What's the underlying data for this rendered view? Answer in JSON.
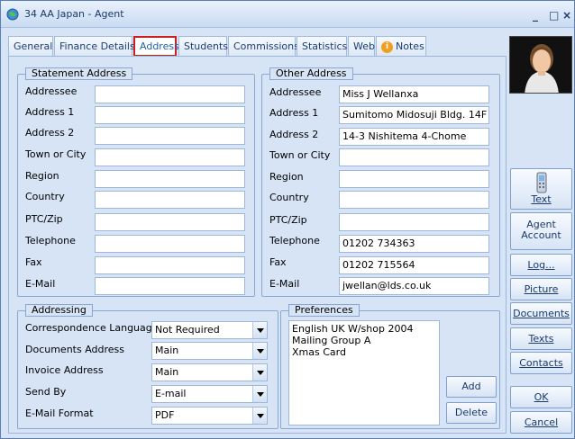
{
  "window": {
    "title": "34 AA Japan - Agent",
    "title_icon": "globe-icon"
  },
  "tabs": [
    {
      "label": "General",
      "active": false
    },
    {
      "label": "Finance Details",
      "active": false
    },
    {
      "label": "Address",
      "active": true
    },
    {
      "label": "Students",
      "active": false
    },
    {
      "label": "Commissions",
      "active": false
    },
    {
      "label": "Statistics",
      "active": false
    },
    {
      "label": "Web",
      "active": false
    },
    {
      "label": "Notes",
      "active": false,
      "icon": "info-icon"
    }
  ],
  "statement_address": {
    "title": "Statement Address",
    "fields": [
      {
        "label": "Addressee",
        "value": ""
      },
      {
        "label": "Address 1",
        "value": ""
      },
      {
        "label": "Address 2",
        "value": ""
      },
      {
        "label": "Town or City",
        "value": ""
      },
      {
        "label": "Region",
        "value": ""
      },
      {
        "label": "Country",
        "value": ""
      },
      {
        "label": "PTC/Zip",
        "value": ""
      },
      {
        "label": "Telephone",
        "value": ""
      },
      {
        "label": "Fax",
        "value": ""
      },
      {
        "label": "E-Mail",
        "value": ""
      }
    ]
  },
  "other_address": {
    "title": "Other Address",
    "fields": [
      {
        "label": "Addressee",
        "value": "Miss J Wellanxa"
      },
      {
        "label": "Address 1",
        "value": "Sumitomo Midosuji Bldg. 14F"
      },
      {
        "label": "Address 2",
        "value": "14-3 Nishitema 4-Chome"
      },
      {
        "label": "Town or City",
        "value": ""
      },
      {
        "label": "Region",
        "value": ""
      },
      {
        "label": "Country",
        "value": ""
      },
      {
        "label": "PTC/Zip",
        "value": ""
      },
      {
        "label": "Telephone",
        "value": "01202 734363"
      },
      {
        "label": "Fax",
        "value": "01202 715564"
      },
      {
        "label": "E-Mail",
        "value": "jwellan@lds.co.uk"
      }
    ]
  },
  "addressing": {
    "title": "Addressing",
    "fields": [
      {
        "label": "Correspondence Language",
        "value": "Not Required"
      },
      {
        "label": "Documents Address",
        "value": "Main"
      },
      {
        "label": "Invoice Address",
        "value": "Main"
      },
      {
        "label": "Send By",
        "value": "E-mail"
      },
      {
        "label": "E-Mail Format",
        "value": "PDF"
      }
    ]
  },
  "preferences": {
    "title": "Preferences",
    "items": [
      "English UK W/shop 2004",
      "Mailing Group A",
      "Xmas Card"
    ],
    "add_label": "Add",
    "delete_label": "Delete"
  },
  "sidebar": {
    "text_label": "Text",
    "agent_account_line1": "Agent",
    "agent_account_line2": "Account",
    "log_label": "Log...",
    "picture_label": "Picture",
    "documents_label": "Documents",
    "texts_label": "Texts",
    "contacts_label": "Contacts",
    "ok_label": "OK",
    "cancel_label": "Cancel"
  }
}
